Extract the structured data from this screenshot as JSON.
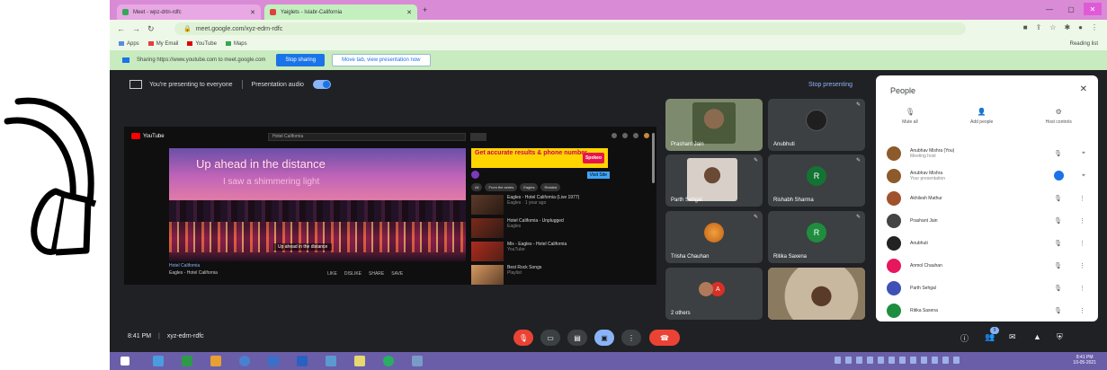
{
  "browser": {
    "tabs": [
      {
        "title": "Meet - wpz-drtn-rdfc",
        "active": false
      },
      {
        "title": "Yaiglets - Islabr-California",
        "active": true
      }
    ],
    "url": "meet.google.com/xyz-edrn-rdfc",
    "bookmarks": [
      "Apps",
      "My Email",
      "YouTube",
      "Maps"
    ],
    "reading_list": "Reading list",
    "sharing_message": "Sharing https://www.youtube.com to meet.google.com",
    "stop_sharing": "Stop sharing",
    "hide_notice": "Move tab, view presentation now"
  },
  "presenting": {
    "message": "You're presenting to everyone",
    "audio_label": "Presentation audio",
    "audio_on": true,
    "stop_label": "Stop presenting"
  },
  "youtube": {
    "search": "Hotel California",
    "video_title": "Up ahead in the distance",
    "video_subtitle": "I saw a shimmering light",
    "caption": "Up ahead in the distance",
    "video_heading": "Hotel California",
    "channel": "Eagles - Hotel California",
    "actions": [
      "LIKE",
      "DISLIKE",
      "SHARE",
      "SAVE"
    ],
    "ad": {
      "headline": "Get accurate results & phone number",
      "button": "Spokeo",
      "visit": "Visit Site"
    },
    "chips": [
      "All",
      "From the series",
      "Eagles",
      "Related"
    ],
    "related": [
      {
        "title": "Eagles - Hotel California (Live 1977)",
        "meta": "Eagles · 1 year ago"
      },
      {
        "title": "Hotel California - Unplugged",
        "meta": "Eagles"
      },
      {
        "title": "Mix - Eagles - Hotel California",
        "meta": "YouTube"
      },
      {
        "title": "Best Rock Songs",
        "meta": "Playlist"
      }
    ]
  },
  "tiles": [
    {
      "name": "Prashant Jain",
      "kind": "video"
    },
    {
      "name": "Anubhuti",
      "kind": "avatar",
      "color": "#1f1f1f",
      "initial": ""
    },
    {
      "name": "Parth Sehgal",
      "kind": "video"
    },
    {
      "name": "Rishabh Sharma",
      "kind": "avatar",
      "color": "#137333",
      "initial": "R"
    },
    {
      "name": "Trisha Chauhan",
      "kind": "avatar",
      "color": "#e37400",
      "initial": ""
    },
    {
      "name": "Ritika Saxena",
      "kind": "avatar",
      "color": "#1e8e3e",
      "initial": "R"
    },
    {
      "name": "2 others",
      "kind": "group",
      "color": "#d93025",
      "initial": "A"
    },
    {
      "name": "",
      "kind": "video"
    }
  ],
  "people": {
    "title": "People",
    "actions": [
      "Mute all",
      "Add people",
      "Host controls"
    ],
    "list": [
      {
        "name": "Anubhav Mishra (You)",
        "sub": "Meeting host",
        "color": "#8d5a2b"
      },
      {
        "name": "Anubhav Mishra",
        "sub": "Your presentation",
        "color": "#8d5a2b"
      },
      {
        "name": "Akhilesh Mathur",
        "sub": "",
        "color": "#a0522d"
      },
      {
        "name": "Prashant Jain",
        "sub": "",
        "color": "#444444"
      },
      {
        "name": "Anubhuti",
        "sub": "",
        "color": "#222222"
      },
      {
        "name": "Anmol Chauhan",
        "sub": "",
        "color": "#e8175d"
      },
      {
        "name": "Parth Sehgal",
        "sub": "",
        "color": "#3f51b5"
      },
      {
        "name": "Ritika Saxena",
        "sub": "",
        "color": "#1e8e3e"
      }
    ]
  },
  "meeting": {
    "time": "8:41 PM",
    "code": "xyz-edrn-rdfc",
    "participant_badge": "9"
  },
  "taskbar": {
    "time": "8:41 PM",
    "date": "10-05-2021"
  }
}
